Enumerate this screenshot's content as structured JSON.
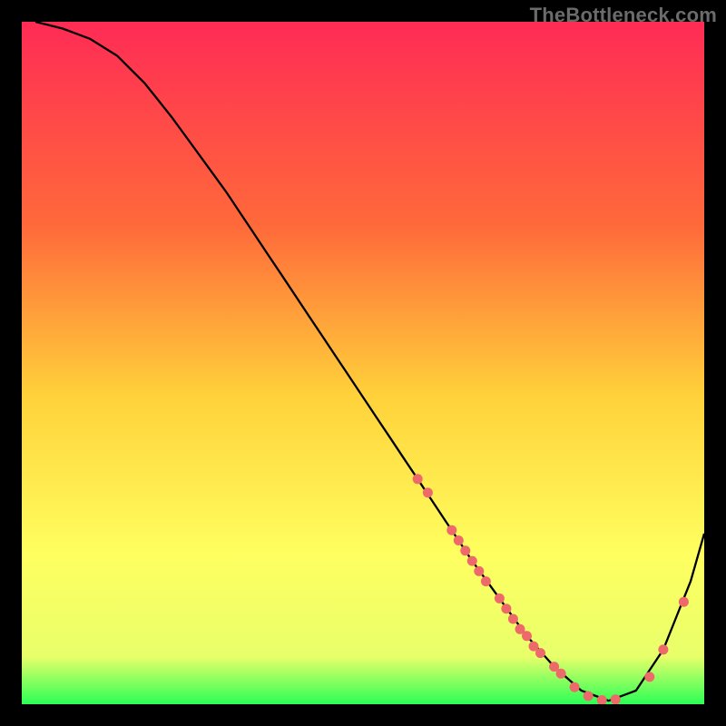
{
  "watermark": "TheBottleneck.com",
  "chart_data": {
    "type": "line",
    "title": "",
    "xlabel": "",
    "ylabel": "",
    "xlim": [
      0,
      100
    ],
    "ylim": [
      0,
      100
    ],
    "gradient_stops": [
      {
        "offset": 0,
        "color": "#ff2b55"
      },
      {
        "offset": 30,
        "color": "#ff6a3a"
      },
      {
        "offset": 55,
        "color": "#ffd23a"
      },
      {
        "offset": 78,
        "color": "#ffff60"
      },
      {
        "offset": 93,
        "color": "#e8ff6a"
      },
      {
        "offset": 100,
        "color": "#2bff55"
      }
    ],
    "series": [
      {
        "name": "bottleneck-curve",
        "x": [
          2,
          6,
          10,
          14,
          18,
          22,
          26,
          30,
          34,
          38,
          42,
          46,
          50,
          54,
          58,
          62,
          66,
          70,
          74,
          78,
          82,
          86,
          90,
          94,
          98,
          100
        ],
        "y": [
          100,
          99,
          97.5,
          95,
          91,
          86,
          80.5,
          75,
          69,
          63,
          57,
          51,
          45,
          39,
          33,
          27,
          21,
          15.5,
          10,
          5.5,
          2,
          0.5,
          2,
          8,
          18,
          25
        ]
      }
    ],
    "scatter_points": {
      "name": "highlight-dots",
      "color": "#ee6a6a",
      "points": [
        {
          "x": 58,
          "y": 33
        },
        {
          "x": 59.5,
          "y": 31
        },
        {
          "x": 63,
          "y": 25.5
        },
        {
          "x": 64,
          "y": 24
        },
        {
          "x": 65,
          "y": 22.5
        },
        {
          "x": 66,
          "y": 21
        },
        {
          "x": 67,
          "y": 19.5
        },
        {
          "x": 68,
          "y": 18
        },
        {
          "x": 70,
          "y": 15.5
        },
        {
          "x": 71,
          "y": 14
        },
        {
          "x": 72,
          "y": 12.5
        },
        {
          "x": 73,
          "y": 11
        },
        {
          "x": 74,
          "y": 10
        },
        {
          "x": 75,
          "y": 8.5
        },
        {
          "x": 76,
          "y": 7.5
        },
        {
          "x": 78,
          "y": 5.5
        },
        {
          "x": 79,
          "y": 4.5
        },
        {
          "x": 81,
          "y": 2.5
        },
        {
          "x": 83,
          "y": 1.2
        },
        {
          "x": 85,
          "y": 0.6
        },
        {
          "x": 87,
          "y": 0.7
        },
        {
          "x": 92,
          "y": 4
        },
        {
          "x": 94,
          "y": 8
        },
        {
          "x": 97,
          "y": 15
        }
      ]
    }
  }
}
